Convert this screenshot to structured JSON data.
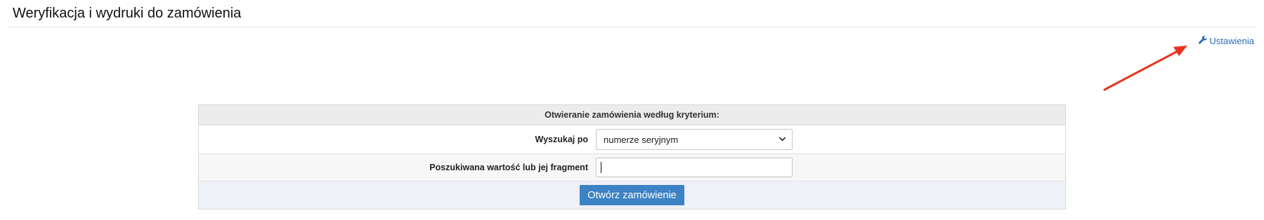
{
  "page": {
    "title": "Weryfikacja i wydruki do zamówienia"
  },
  "settings": {
    "label": "Ustawienia",
    "icon": "wrench-icon",
    "color": "#2a6db0"
  },
  "annotation": {
    "color": "#e8321e"
  },
  "form": {
    "header": "Otwieranie zamówienia według kryterium:",
    "search_by_label": "Wyszukaj po",
    "search_by_value": "numerze seryjnym",
    "search_value_label": "Poszukiwana wartość lub jej fragment",
    "search_value_input": "",
    "submit_label": "Otwórz zamówienie",
    "submit_color": "#3c82c4"
  }
}
